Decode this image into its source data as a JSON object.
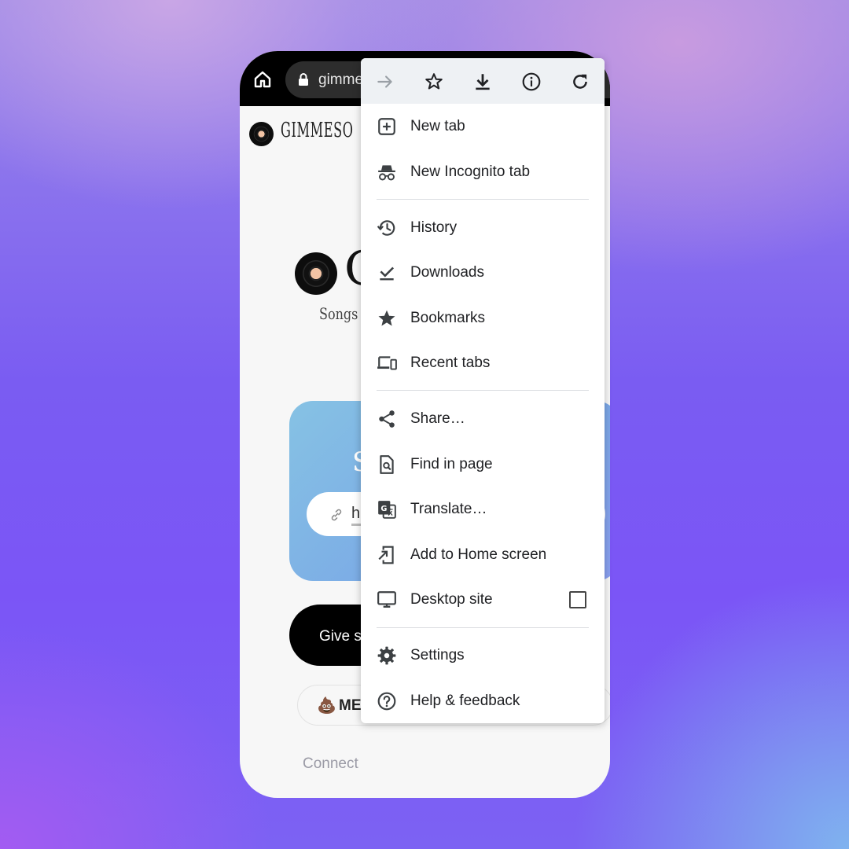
{
  "browser": {
    "url_text": "gimme",
    "toolbar_icons": [
      "forward-icon",
      "bookmark-star-icon",
      "download-icon",
      "info-icon",
      "reload-icon"
    ]
  },
  "page": {
    "brand": "GIMMESO",
    "hero_letter": "G",
    "tagline": "Songs f",
    "card_letter": "S",
    "input_text": "h",
    "give_button": "Give s",
    "meme_emoji": "💩",
    "meme_label": "ME",
    "connect": "Connect"
  },
  "menu": {
    "new_tab": "New tab",
    "incognito": "New Incognito tab",
    "history": "History",
    "downloads": "Downloads",
    "bookmarks": "Bookmarks",
    "recent_tabs": "Recent tabs",
    "share": "Share…",
    "find": "Find in page",
    "translate": "Translate…",
    "add_home": "Add to Home screen",
    "desktop_site": "Desktop site",
    "settings": "Settings",
    "help": "Help & feedback"
  },
  "colors": {
    "menu_text": "#202124",
    "icon": "#3c4043",
    "toolbar_bg": "#eef1f4"
  }
}
